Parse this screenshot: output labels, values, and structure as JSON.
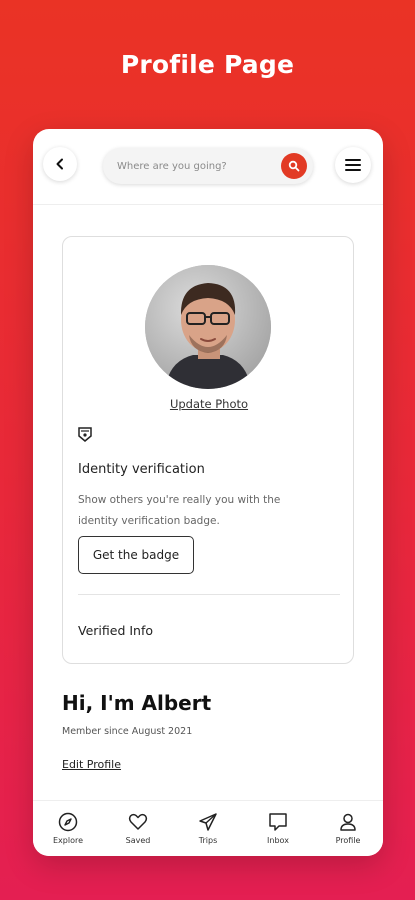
{
  "promo_title": "Profile Page",
  "search": {
    "placeholder": "Where are you going?"
  },
  "profile": {
    "update_photo": "Update Photo",
    "identity_title": "Identity verification",
    "identity_desc": "Show others you're really you with the identity verification badge.",
    "badge_button": "Get the badge",
    "verified_info": "Verified Info",
    "greeting": "Hi, I'm Albert",
    "member_since": "Member since August 2021",
    "edit_profile": "Edit Profile"
  },
  "nav": [
    {
      "label": "Explore",
      "icon": "compass-icon"
    },
    {
      "label": "Saved",
      "icon": "heart-icon"
    },
    {
      "label": "Trips",
      "icon": "paper-plane-icon"
    },
    {
      "label": "Inbox",
      "icon": "message-icon"
    },
    {
      "label": "Profile",
      "icon": "user-icon"
    }
  ],
  "colors": {
    "accent": "#e23a24",
    "background": "#e8283a"
  }
}
